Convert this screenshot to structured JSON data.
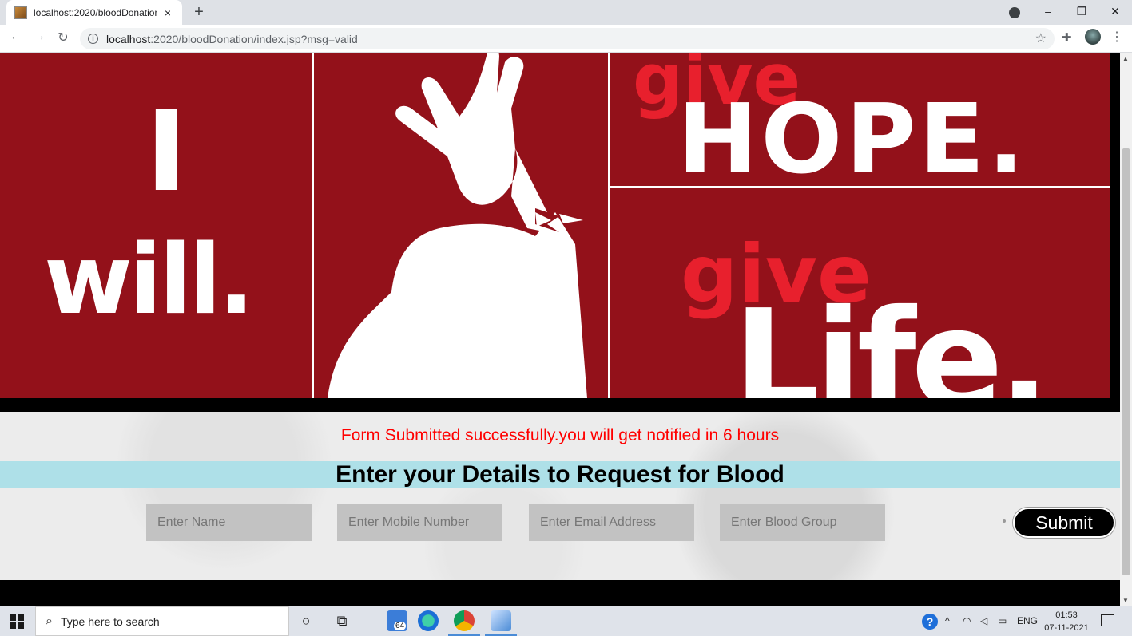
{
  "browser": {
    "tab_title": "localhost:2020/bloodDonation/index.jsp?msg=valid",
    "tab_close": "×",
    "new_tab": "+",
    "url_host": "localhost",
    "url_path": ":2020/bloodDonation/index.jsp?msg=valid",
    "window_controls": {
      "minimize": "–",
      "maximize": "❐",
      "close": "✕"
    }
  },
  "banner": {
    "left_big": "I",
    "left_word": "will.",
    "top_red": "give",
    "top_white": "HOPE.",
    "bottom_red": "give",
    "bottom_white": "Life."
  },
  "form": {
    "success_message": "Form Submitted successfully.you will get notified in 6 hours",
    "heading": "Enter your Details to Request for Blood",
    "name_placeholder": "Enter Name",
    "mobile_placeholder": "Enter Mobile Number",
    "email_placeholder": "Enter Email Address",
    "blood_placeholder": "Enter Blood Group",
    "submit_label": "Submit"
  },
  "taskbar": {
    "search_placeholder": "Type here to search",
    "language": "ENG",
    "time": "01:53",
    "date": "07-11-2021",
    "badge_count": "64"
  },
  "colors": {
    "banner_red": "#93111a",
    "accent_red": "#e8202d",
    "success_text": "#ff0000",
    "heading_bar": "#aee0e8"
  }
}
